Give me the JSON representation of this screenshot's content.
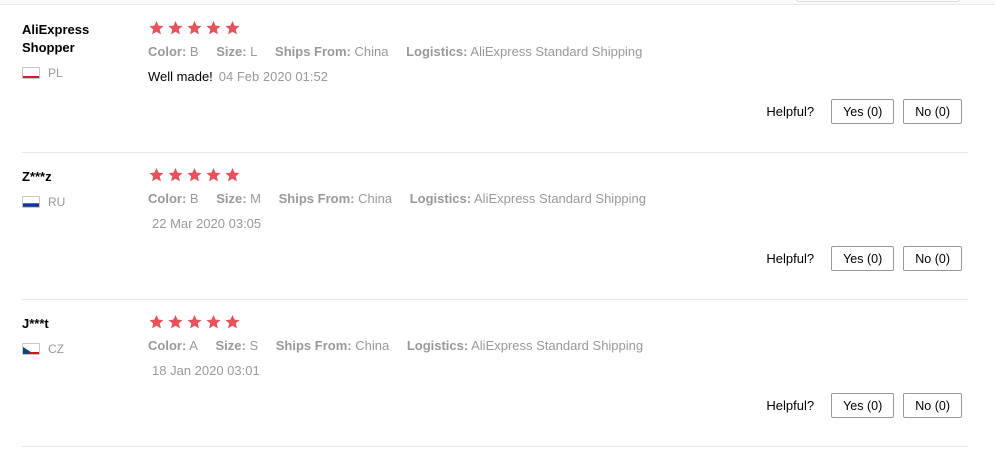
{
  "reviews": [
    {
      "user": "AliExpress Shopper",
      "country": "PL",
      "flag": [
        "#ffffff",
        "#dc143c"
      ],
      "attributes": [
        {
          "label": "Color:",
          "value": "B"
        },
        {
          "label": "Size:",
          "value": "L"
        },
        {
          "label": "Ships From:",
          "value": "China"
        },
        {
          "label": "Logistics:",
          "value": "AliExpress Standard Shipping"
        }
      ],
      "comment": "Well made!",
      "date": "04 Feb 2020 01:52",
      "helpful_label": "Helpful?",
      "yes_label": "Yes (0)",
      "no_label": "No (0)"
    },
    {
      "user": "Z***z",
      "country": "RU",
      "flag": [
        "#ffffff",
        "#0039a6",
        "#d52b1e"
      ],
      "attributes": [
        {
          "label": "Color:",
          "value": "B"
        },
        {
          "label": "Size:",
          "value": "M"
        },
        {
          "label": "Ships From:",
          "value": "China"
        },
        {
          "label": "Logistics:",
          "value": "AliExpress Standard Shipping"
        }
      ],
      "comment": "",
      "date": "22 Mar 2020 03:05",
      "helpful_label": "Helpful?",
      "yes_label": "Yes (0)",
      "no_label": "No (0)"
    },
    {
      "user": "J***t",
      "country": "CZ",
      "flag": [
        "#ffffff",
        "#d7141a",
        "#11457e"
      ],
      "attributes": [
        {
          "label": "Color:",
          "value": "A"
        },
        {
          "label": "Size:",
          "value": "S"
        },
        {
          "label": "Ships From:",
          "value": "China"
        },
        {
          "label": "Logistics:",
          "value": "AliExpress Standard Shipping"
        }
      ],
      "comment": "",
      "date": "18 Jan 2020 03:01",
      "helpful_label": "Helpful?",
      "yes_label": "Yes (0)",
      "no_label": "No (0)"
    }
  ],
  "rating_stars": 5,
  "star_color": "#e8525a",
  "star_icon": "star-icon"
}
